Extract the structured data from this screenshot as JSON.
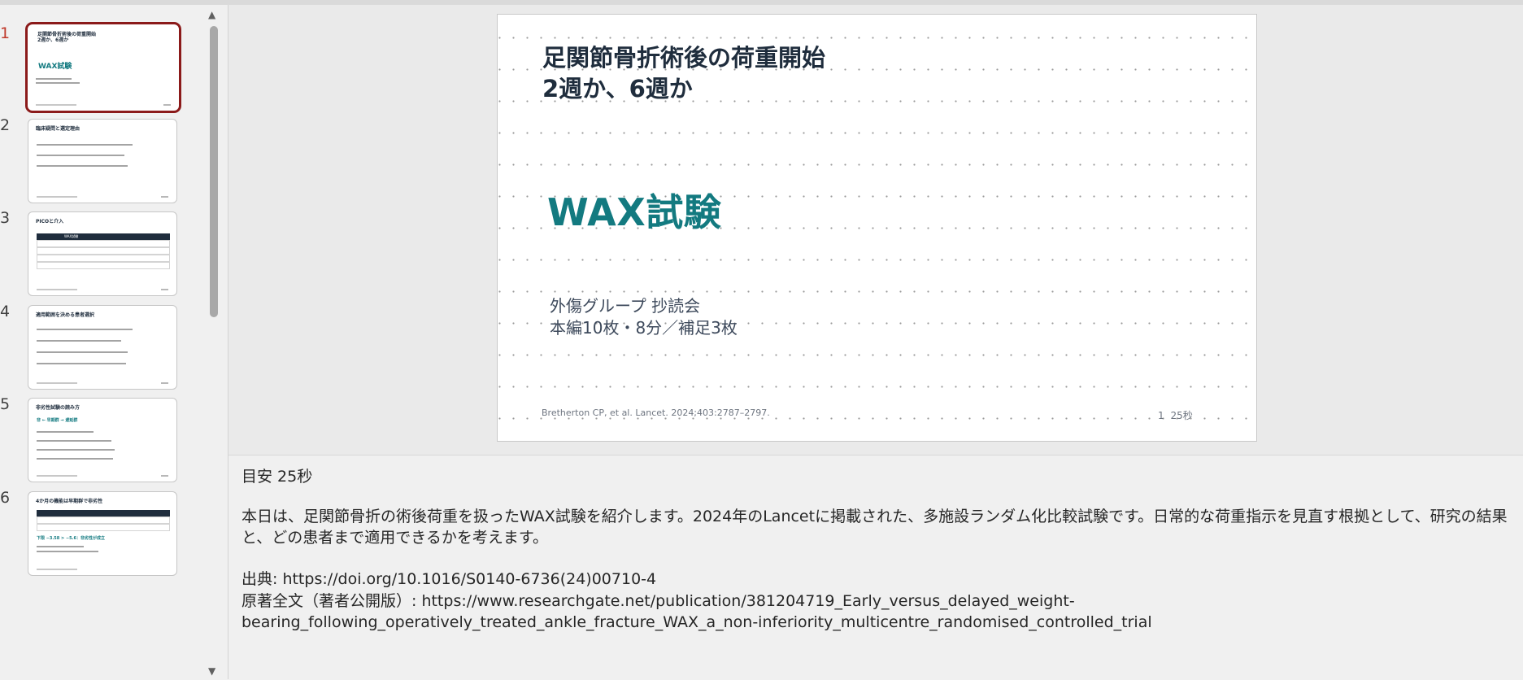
{
  "slides_panel": {
    "thumbnails": [
      {
        "number": "1",
        "title_line1": "足関節骨折術後の荷重開始",
        "title_line2": "2週か、6週か",
        "heading": "WAX試験"
      },
      {
        "number": "2",
        "title": "臨床疑問と選定理由"
      },
      {
        "number": "3",
        "title": "PICOと介入",
        "table_header": "WAX試験"
      },
      {
        "number": "4",
        "title": "適用範囲を決める患者選択"
      },
      {
        "number": "5",
        "title": "非劣性試験の読み方",
        "heading": "非 ← 早期群 → 遅延群"
      },
      {
        "number": "6",
        "title": "4か月の機能は早期群で非劣性",
        "heading": "下限 −3.58 > −5.6：非劣性が成立"
      }
    ]
  },
  "slide": {
    "title_line1": "足関節骨折術後の荷重開始",
    "title_line2": "2週か、6週か",
    "heading": "WAX試験",
    "subtitle_line1": "外傷グループ 抄読会",
    "subtitle_line2": "本編10枚・8分／補足3枚",
    "citation": "Bretherton CP, et al. Lancet. 2024;403:2787–2797.",
    "slide_number": "1",
    "timing": "25秒"
  },
  "notes": {
    "time_guide": "目安 25秒",
    "body": "本日は、足関節骨折の術後荷重を扱ったWAX試験を紹介します。2024年のLancetに掲載された、多施設ランダム化比較試験です。日常的な荷重指示を見直す根拠として、研究の結果と、どの患者まで適用できるかを考えます。",
    "source": "出典: https://doi.org/10.1016/S0140-6736(24)00710-4",
    "fulltext_line1": "原著全文（著者公開版）: https://www.researchgate.net/publication/381204719_Early_versus_delayed_weight-",
    "fulltext_line2": "bearing_following_operatively_treated_ankle_fracture_WAX_a_non-inferiority_multicentre_randomised_controlled_trial"
  },
  "colors": {
    "selected_border": "#8b1a1a",
    "active_number": "#c0392b",
    "title_navy": "#1f2d3d",
    "accent_teal": "#137a80"
  },
  "icons": {
    "scroll_up": "triangle-up",
    "scroll_down": "triangle-down"
  }
}
